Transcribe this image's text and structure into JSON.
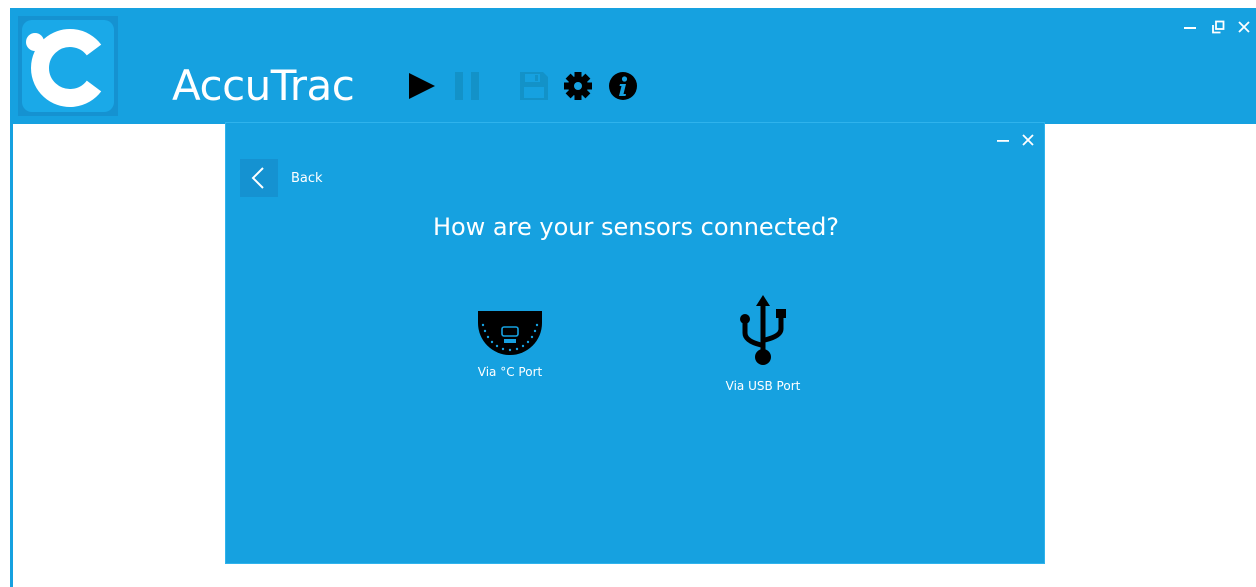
{
  "app": {
    "title": "AccuTrac",
    "logo_icon": "accutrac-c-logo-icon",
    "colors": {
      "header": "#16a1e0",
      "logo_tile": "#1592d1",
      "icon_dark": "#000000",
      "icon_disabled": "#1392c8"
    }
  },
  "toolbar": {
    "play_icon": "play-icon",
    "pause_icon": "pause-icon",
    "save_icon": "floppy-disk-icon",
    "settings_icon": "gear-icon",
    "info_icon": "info-icon"
  },
  "window_controls": [
    "minimize-icon",
    "restore-icon",
    "close-icon"
  ],
  "dialog": {
    "back_label": "Back",
    "question": "How are your sensors connected?",
    "controls": [
      "minimize-icon",
      "close-icon"
    ],
    "options": [
      {
        "label": "Via °C Port",
        "icon": "i2c-sensor-port-icon"
      },
      {
        "label": "Via USB Port",
        "icon": "usb-icon"
      }
    ]
  }
}
